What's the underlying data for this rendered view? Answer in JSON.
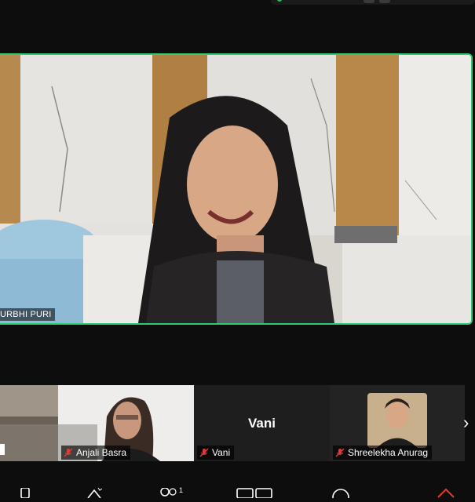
{
  "main_video": {
    "speaker_name": "URBHI PURI"
  },
  "participants": [
    {
      "name": ""
    },
    {
      "name": "Anjali Basra"
    },
    {
      "name": "Vani",
      "display_name": "Vani"
    },
    {
      "name": "Shreelekha Anurag"
    }
  ],
  "toolbar": {
    "participants_count": "1"
  },
  "colors": {
    "active_speaker_border": "#2ecc71",
    "mic_off": "#e53935",
    "end_call": "#e53935"
  },
  "icons": [
    "mic-off-icon",
    "chevron-right-icon",
    "audio-icon",
    "effects-icon",
    "participants-icon",
    "view-icon",
    "more-icon",
    "leave-icon"
  ]
}
